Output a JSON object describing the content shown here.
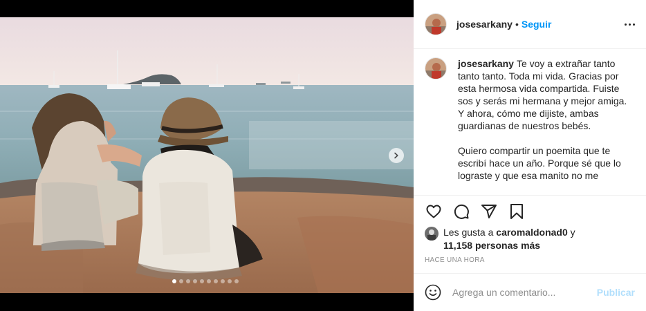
{
  "post": {
    "username": "josesarkany",
    "follow_label": "Seguir",
    "separator": "•",
    "caption": "Te voy a extrañar tanto tanto tanto. Toda mi vida. Gracias por esta hermosa vida compartida. Fuiste sos y serás mi hermana y mejor amiga. Y ahora, cómo me dijiste, ambas guardianas de nuestros bebés.\n\nQuiero compartir un poemita que te escribí hace un año. Porque sé que lo lograste y que esa manito no me",
    "likes": {
      "prefix": "Les gusta a",
      "liker": "caromaldonad0",
      "connector": "y",
      "count_text": "11,158 personas más"
    },
    "timestamp": "HACE UNA HORA",
    "comment": {
      "placeholder": "Agrega un comentario...",
      "post_label": "Publicar"
    }
  },
  "carousel": {
    "total": 10,
    "active_index": 0
  },
  "icons": {
    "like": "heart-icon",
    "comment": "comment-icon",
    "share": "share-icon",
    "save": "bookmark-icon",
    "emoji": "emoji-icon",
    "more": "more-options-icon",
    "next": "chevron-right-icon"
  },
  "colors": {
    "accent": "#0095f6",
    "post_disabled": "#b2dffc",
    "muted": "#8e8e8e"
  }
}
